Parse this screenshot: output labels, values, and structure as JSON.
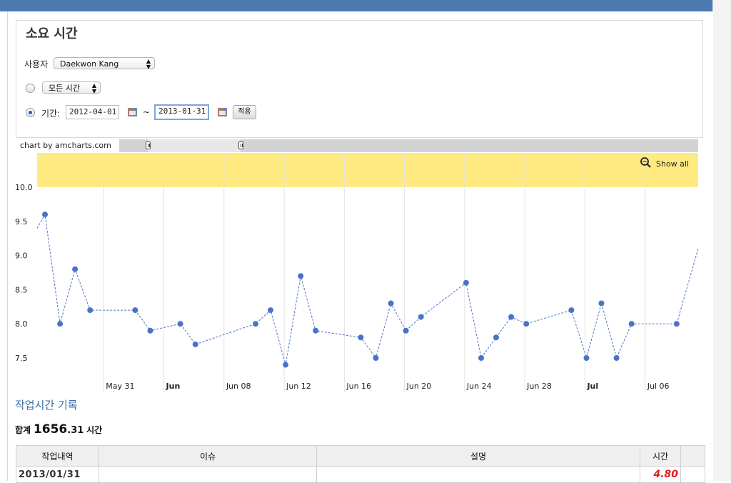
{
  "filter": {
    "title": "소요 시간",
    "user_label": "사용자",
    "user_value": "Daekwon Kang",
    "all_time_option": "모든 시간",
    "period_label": "기간:",
    "start_date": "2012-04-01",
    "range_separator": "~",
    "end_date": "2013-01-31",
    "apply_button": "적용"
  },
  "chart": {
    "credit": "chart by amcharts.com",
    "show_all": "Show all",
    "show_all_icon": "magnifier-icon",
    "band_color": "#ffea82",
    "line_color": "#4a72c8"
  },
  "chart_data": {
    "type": "line",
    "y_ticks": [
      "10.0",
      "9.5",
      "9.0",
      "8.5",
      "8.0",
      "7.5"
    ],
    "ylim": [
      7.1,
      10.5
    ],
    "x_ticks": [
      {
        "label": "May 31",
        "bold": false,
        "x": "2012-05-31"
      },
      {
        "label": "Jun",
        "bold": true,
        "x": "2012-06-04"
      },
      {
        "label": "Jun 08",
        "bold": false,
        "x": "2012-06-08"
      },
      {
        "label": "Jun 12",
        "bold": false,
        "x": "2012-06-12"
      },
      {
        "label": "Jun 16",
        "bold": false,
        "x": "2012-06-16"
      },
      {
        "label": "Jun 20",
        "bold": false,
        "x": "2012-06-20"
      },
      {
        "label": "Jun 24",
        "bold": false,
        "x": "2012-06-24"
      },
      {
        "label": "Jun 28",
        "bold": false,
        "x": "2012-06-28"
      },
      {
        "label": "Jul",
        "bold": true,
        "x": "2012-07-02"
      },
      {
        "label": "Jul 06",
        "bold": false,
        "x": "2012-07-06"
      }
    ],
    "x_range": [
      "2012-05-27",
      "2012-07-10"
    ],
    "series": [
      {
        "points": [
          {
            "x": "2012-05-27",
            "y": 9.6
          },
          {
            "x": "2012-05-28",
            "y": 8.0
          },
          {
            "x": "2012-05-29",
            "y": 8.8
          },
          {
            "x": "2012-05-30",
            "y": 8.2
          },
          {
            "x": "2012-06-02",
            "y": 8.2
          },
          {
            "x": "2012-06-03",
            "y": 7.9
          },
          {
            "x": "2012-06-05",
            "y": 8.0
          },
          {
            "x": "2012-06-06",
            "y": 7.7
          },
          {
            "x": "2012-06-10",
            "y": 8.0
          },
          {
            "x": "2012-06-11",
            "y": 8.2
          },
          {
            "x": "2012-06-12",
            "y": 7.4
          },
          {
            "x": "2012-06-13",
            "y": 8.7
          },
          {
            "x": "2012-06-14",
            "y": 7.9
          },
          {
            "x": "2012-06-17",
            "y": 7.8
          },
          {
            "x": "2012-06-18",
            "y": 7.5
          },
          {
            "x": "2012-06-19",
            "y": 8.3
          },
          {
            "x": "2012-06-20",
            "y": 7.9
          },
          {
            "x": "2012-06-21",
            "y": 8.1
          },
          {
            "x": "2012-06-24",
            "y": 8.6
          },
          {
            "x": "2012-06-25",
            "y": 7.5
          },
          {
            "x": "2012-06-26",
            "y": 7.8
          },
          {
            "x": "2012-06-27",
            "y": 8.1
          },
          {
            "x": "2012-06-28",
            "y": 8.0
          },
          {
            "x": "2012-07-01",
            "y": 8.2
          },
          {
            "x": "2012-07-02",
            "y": 7.5
          },
          {
            "x": "2012-07-03",
            "y": 8.3
          },
          {
            "x": "2012-07-04",
            "y": 7.5
          },
          {
            "x": "2012-07-05",
            "y": 8.0
          },
          {
            "x": "2012-07-08",
            "y": 8.0
          }
        ]
      }
    ],
    "grid": true
  },
  "log": {
    "title": "작업시간 기록",
    "total_label": "합계",
    "total_int": "1656",
    "total_frac": ".31",
    "total_unit": "시간",
    "columns": [
      "작업내역",
      "이슈",
      "설명",
      "시간",
      ""
    ],
    "rows": [
      {
        "date": "2013/01/31",
        "issue": "",
        "desc": "",
        "hours": "4.80"
      }
    ]
  }
}
